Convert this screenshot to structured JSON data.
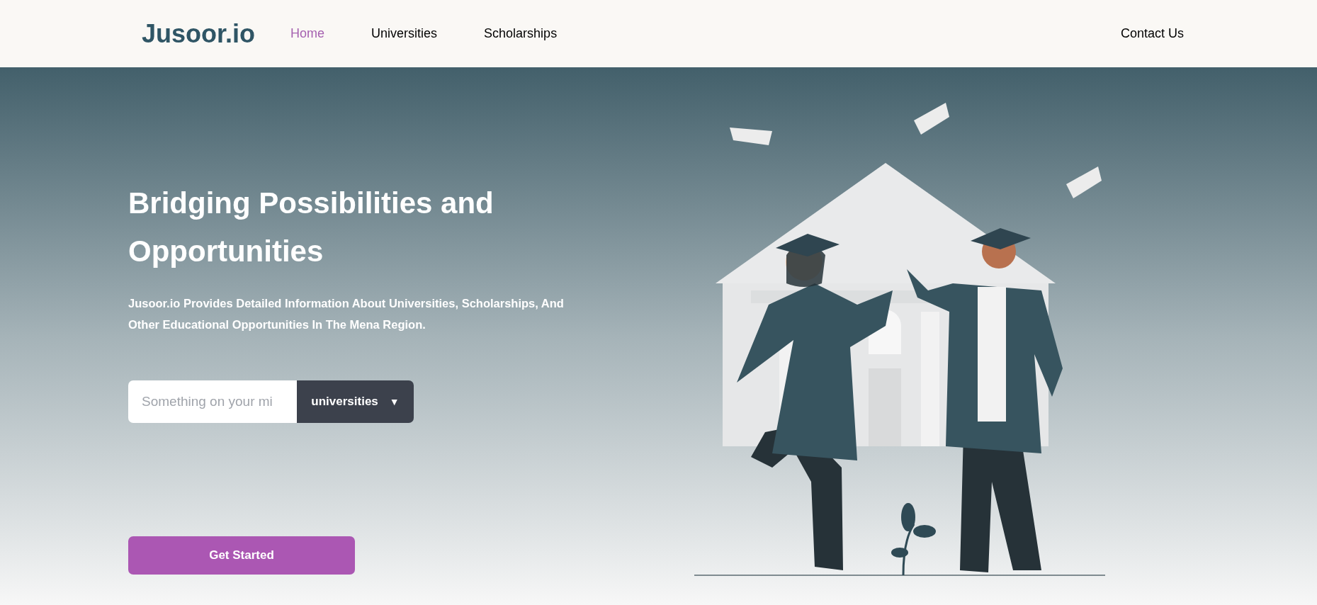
{
  "header": {
    "logo": "Jusoor.io",
    "nav": [
      {
        "label": "Home",
        "selected": true
      },
      {
        "label": "Universities",
        "selected": false
      },
      {
        "label": "Scholarships",
        "selected": false
      }
    ],
    "contact": "Contact Us"
  },
  "hero": {
    "title": "Bridging Possibilities and Opportunities",
    "description": "Jusoor.io Provides Detailed Information About Universities, Scholarships, And Other Educational Opportunities In The Mena Region.",
    "search": {
      "placeholder": "Something on your mi",
      "category": "universities",
      "caret": "▼"
    },
    "cta": "Get Started"
  }
}
